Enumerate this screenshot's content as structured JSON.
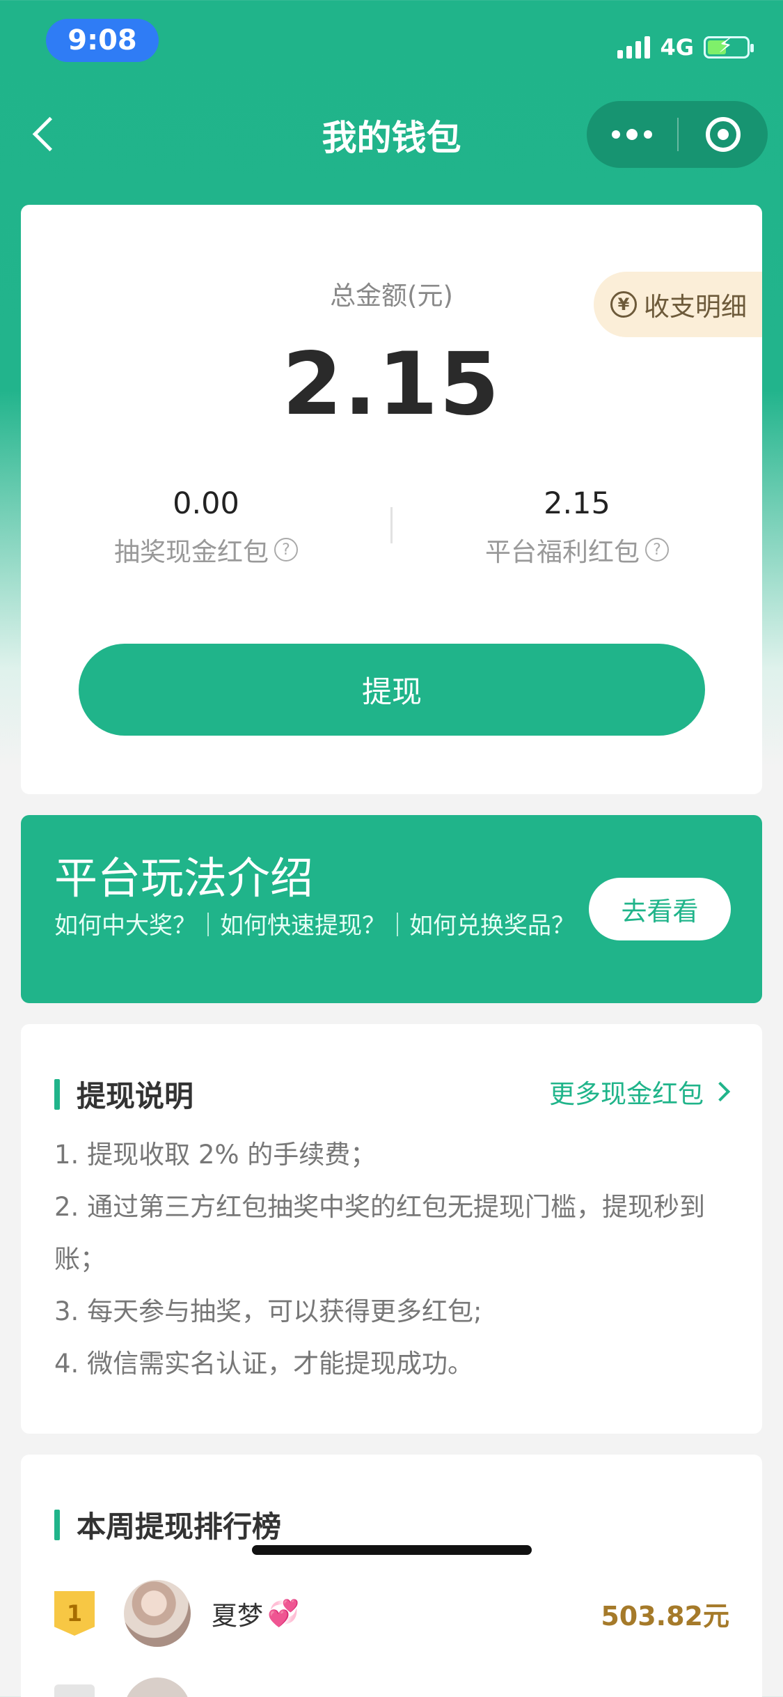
{
  "status_bar": {
    "time": "9:08",
    "network": "4G"
  },
  "nav": {
    "title": "我的钱包"
  },
  "wallet": {
    "total_label": "总金额(元)",
    "total_amount": "2.15",
    "detail_button": "收支明细",
    "lottery_cash": {
      "value": "0.00",
      "label": "抽奖现金红包"
    },
    "platform_bonus": {
      "value": "2.15",
      "label": "平台福利红包"
    },
    "withdraw_button": "提现"
  },
  "intro": {
    "title": "平台玩法介绍",
    "description": "如何中大奖？｜如何快速提现？｜如何兑换奖品？",
    "button": "去看看"
  },
  "withdraw_notes": {
    "title": "提现说明",
    "more_link": "更多现金红包",
    "items": [
      "1. 提现收取 2% 的手续费；",
      "2. 通过第三方红包抽奖中奖的红包无提现门槛，提现秒到账；",
      "3. 每天参与抽奖，可以获得更多红包;",
      "4. 微信需实名认证，才能提现成功。"
    ]
  },
  "ranking": {
    "title": "本周提现排行榜",
    "rows": [
      {
        "rank": "1",
        "name": "夏梦",
        "emoji": "💞",
        "amount": "503.82元"
      }
    ]
  },
  "colors": {
    "primary": "#20b48a",
    "gold": "#a57a2a",
    "badge": "#f7c744"
  }
}
